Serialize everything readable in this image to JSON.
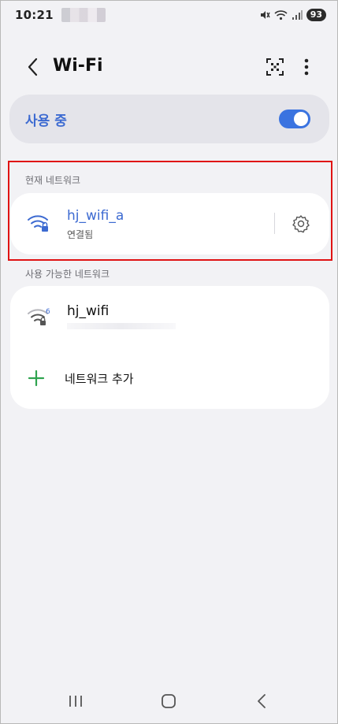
{
  "status_bar": {
    "time": "10:21",
    "battery": "93",
    "icons": [
      "mute-icon",
      "wifi-icon",
      "signal-icon"
    ]
  },
  "header": {
    "title": "Wi-Fi",
    "icons": [
      "back-icon",
      "qr-scan-icon",
      "more-options-icon"
    ]
  },
  "toggle": {
    "label": "사용 중",
    "state": true,
    "accent_color": "#3a73e0"
  },
  "current_network": {
    "section_label": "현재 네트워크",
    "name": "hj_wifi_a",
    "status": "연결됨",
    "icon": "wifi-lock-icon",
    "action_icon": "gear-icon"
  },
  "available_networks": {
    "section_label": "사용 가능한 네트워크",
    "items": [
      {
        "name": "hj_wifi",
        "icon": "wifi-lock-6ghz-icon"
      }
    ],
    "add_label": "네트워크 추가"
  },
  "nav_bar": {
    "icons": [
      "recents-icon",
      "home-icon",
      "back-icon"
    ]
  },
  "colors": {
    "accent": "#3c6ad1",
    "highlight": "#e01313",
    "background": "#f2f2f5",
    "add_icon": "#2fa34f"
  }
}
